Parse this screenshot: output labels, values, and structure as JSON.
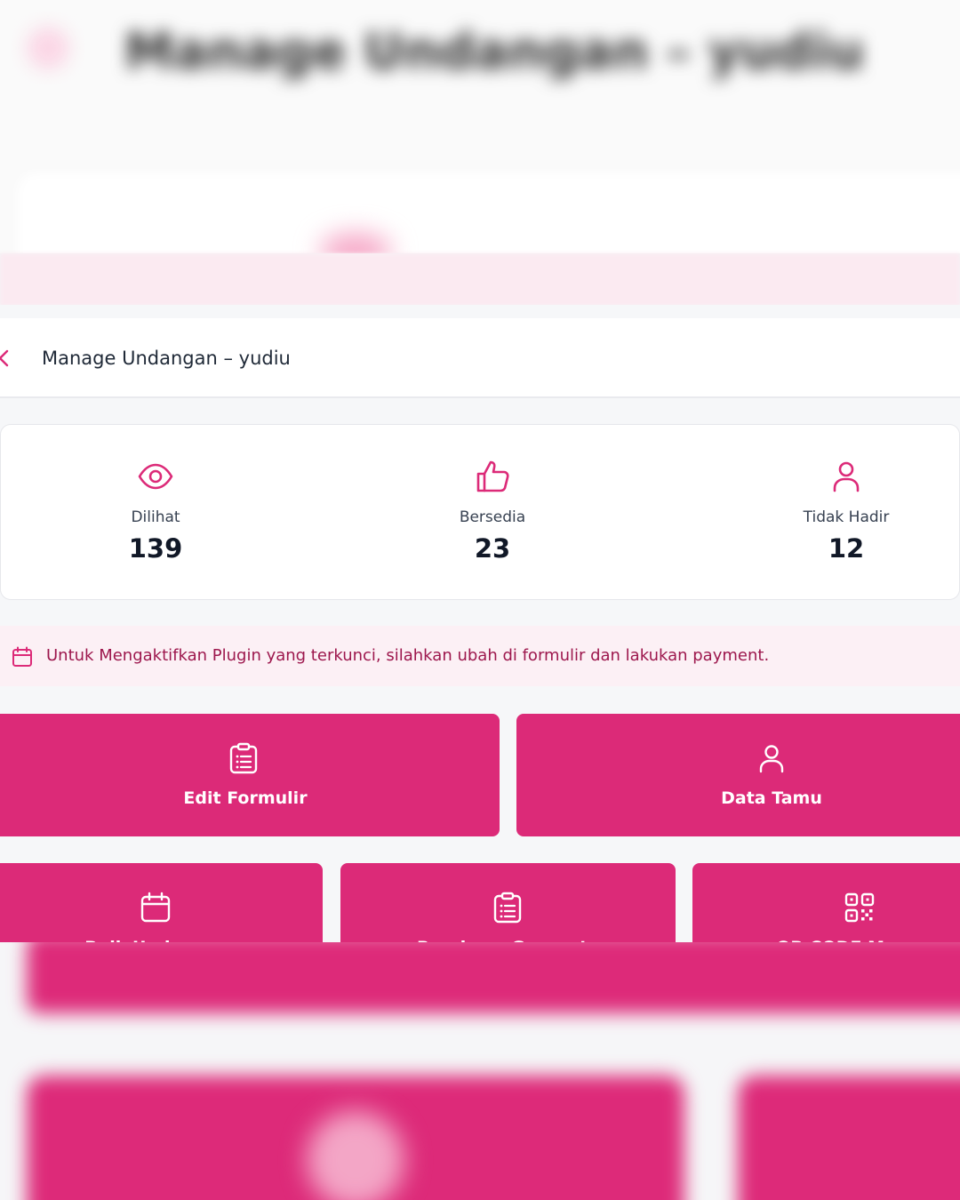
{
  "header": {
    "title": "Manage Undangan – yudiu"
  },
  "stats": [
    {
      "icon": "eye-icon",
      "label": "Dilihat",
      "value": "139"
    },
    {
      "icon": "thumbs-up-icon",
      "label": "Bersedia",
      "value": "23"
    },
    {
      "icon": "user-icon",
      "label": "Tidak Hadir",
      "value": "12"
    }
  ],
  "notice": {
    "icon": "calendar-icon",
    "text": "Untuk Mengaktifkan Plugin yang terkunci, silahkan ubah di formulir dan lakukan payment."
  },
  "actions": [
    {
      "icon": "clipboard-list-icon",
      "label": "Edit Formulir"
    },
    {
      "icon": "user-icon",
      "label": "Data Tamu"
    },
    {
      "icon": "calendar-icon",
      "label": "Bulk Undangan"
    },
    {
      "icon": "clipboard-list-icon",
      "label": "Rundown Generate"
    },
    {
      "icon": "qr-code-icon",
      "label": "QR CODE Manage"
    }
  ],
  "colors": {
    "accent": "#dc2a78",
    "notice_bg": "#fcf0f5",
    "notice_text": "#9d174d"
  }
}
